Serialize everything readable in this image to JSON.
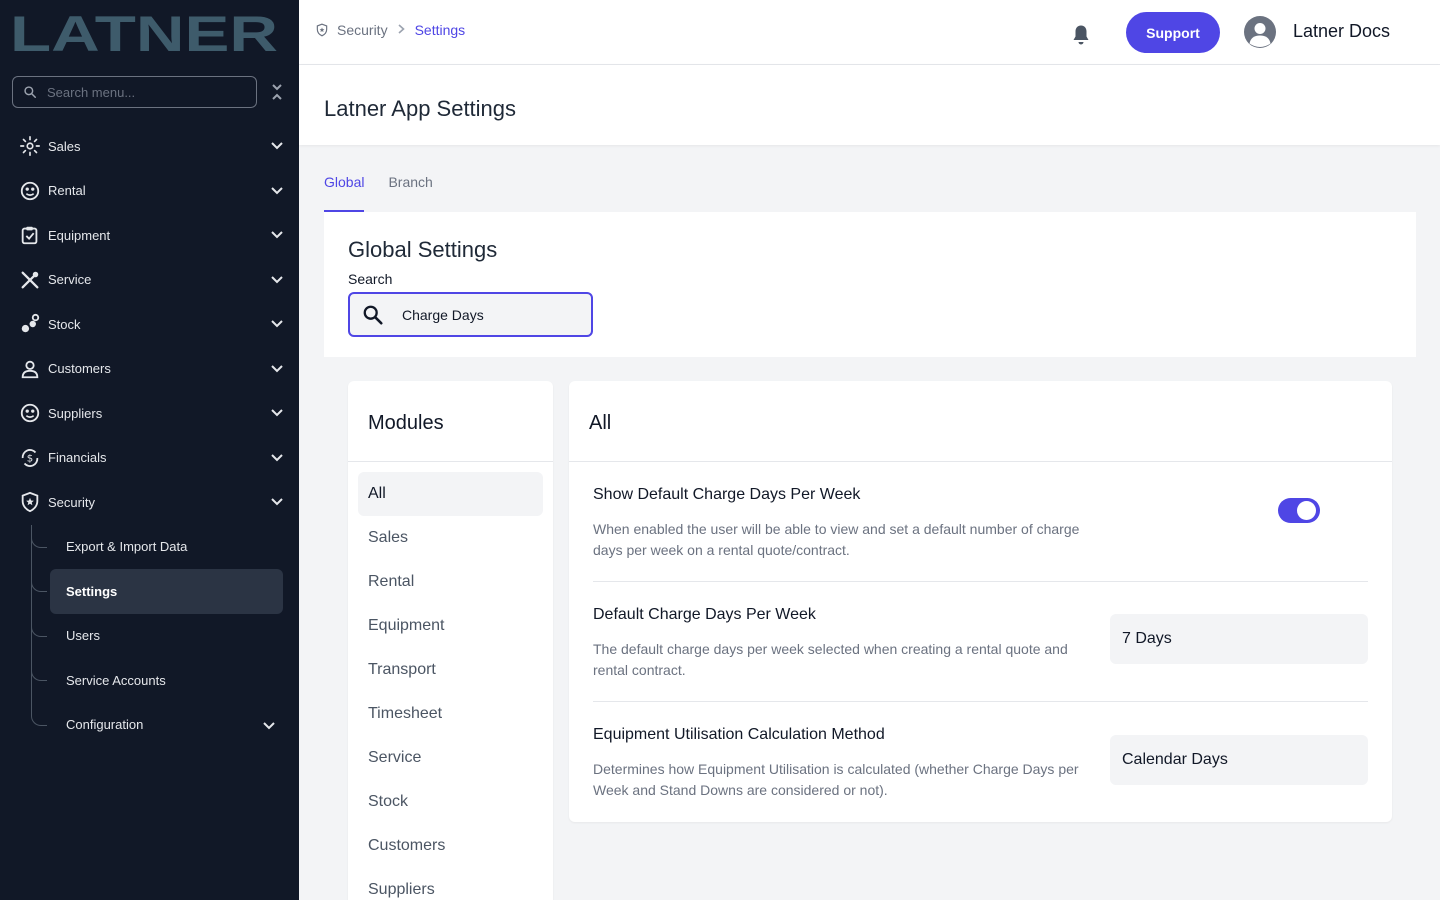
{
  "app": {
    "logo_text": "LATNER"
  },
  "sidebar": {
    "search_placeholder": "Search menu...",
    "items": [
      {
        "label": "Sales",
        "icon": "sales-icon"
      },
      {
        "label": "Rental",
        "icon": "rental-icon"
      },
      {
        "label": "Equipment",
        "icon": "equipment-icon"
      },
      {
        "label": "Service",
        "icon": "service-icon"
      },
      {
        "label": "Stock",
        "icon": "stock-icon"
      },
      {
        "label": "Customers",
        "icon": "customers-icon"
      },
      {
        "label": "Suppliers",
        "icon": "suppliers-icon"
      },
      {
        "label": "Financials",
        "icon": "financials-icon"
      },
      {
        "label": "Security",
        "icon": "security-icon"
      }
    ],
    "security_sub": [
      {
        "label": "Export & Import Data"
      },
      {
        "label": "Settings"
      },
      {
        "label": "Users"
      },
      {
        "label": "Service Accounts"
      },
      {
        "label": "Configuration"
      }
    ]
  },
  "header": {
    "breadcrumb": {
      "section": "Security",
      "current": "Settings"
    },
    "support_label": "Support",
    "user_name": "Latner Docs"
  },
  "page": {
    "title": "Latner App Settings",
    "tabs": [
      {
        "label": "Global"
      },
      {
        "label": "Branch"
      }
    ]
  },
  "global": {
    "title": "Global Settings",
    "search_label": "Search",
    "search_value": "Charge Days"
  },
  "modules": {
    "title": "Modules",
    "items": [
      "All",
      "Sales",
      "Rental",
      "Equipment",
      "Transport",
      "Timesheet",
      "Service",
      "Stock",
      "Customers",
      "Suppliers"
    ]
  },
  "settings": {
    "title": "All",
    "items": [
      {
        "title": "Show Default Charge Days Per Week",
        "description": "When enabled the user will be able to view and set a default number of charge days per week on a rental quote/contract."
      },
      {
        "title": "Default Charge Days Per Week",
        "description": "The default charge days per week selected when creating a rental quote and rental contract.",
        "value": "7 Days"
      },
      {
        "title": "Equipment Utilisation Calculation Method",
        "description": "Determines how Equipment Utilisation is calculated (whether Charge Days per Week and Stand Downs are considered or not).",
        "value": "Calendar Days"
      }
    ]
  },
  "colors": {
    "accent": "#4f46e5",
    "sidebar_bg": "#111827",
    "logo_color": "#3e5b6b"
  }
}
